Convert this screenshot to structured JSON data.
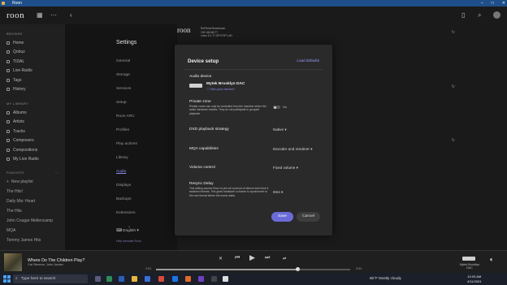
{
  "window": {
    "title": "Roon"
  },
  "app": {
    "logo": "roon"
  },
  "sidebar": {
    "browse_header": "BROWSE",
    "browse": [
      "Home",
      "Qobuz",
      "TIDAL",
      "Live Radio",
      "Tags",
      "History"
    ],
    "library_header": "MY LIBRARY",
    "library": [
      "Albums",
      "Artists",
      "Tracks",
      "Composers",
      "Compositions",
      "My Live Radio"
    ],
    "playlists_header": "PLAYLISTS",
    "new_playlist": "New playlist",
    "playlists": [
      "The Hits!",
      "Daily Mix: Heart",
      "The Hits",
      "John Cougar Mellencamp",
      "MQA",
      "Tommy James Hits"
    ]
  },
  "settings": {
    "title": "Settings",
    "nav": [
      "General",
      "Storage",
      "Services",
      "Setup",
      "Roon ARC",
      "Profiles",
      "Play actions",
      "Library",
      "Audio",
      "Displays",
      "Backups",
      "Extensions"
    ],
    "active": "Audio",
    "language": "English",
    "language_help": "Help translate Roon"
  },
  "info_panel": {
    "logo": "roon",
    "device_lines": [
      "RoPieee/Gearbroom",
      "192.168.68.77",
      "Linux 6.1.77-SPOTIFY-v8+"
    ]
  },
  "modal": {
    "title": "Device setup",
    "load_defaults": "Load defaults",
    "audio_device_label": "Audio device",
    "device_name": "Mytek Brooklyn DAC",
    "device_link": "Not your device?",
    "private_zone_label": "Private zone",
    "private_zone_desc": "Private zones can only be controlled from the machine where the audio hardware resides. They do not participate in grouped playback.",
    "private_zone_value": "No",
    "dsd_label": "DSD playback strategy",
    "dsd_value": "Native",
    "mqa_label": "MQA capabilities",
    "mqa_value": "Decoder and renderer",
    "volume_label": "Volume control",
    "volume_value": "Fixed volume",
    "resync_label": "Resync Delay",
    "resync_desc": "This setting causes Roon to pre-roll a period of silence each time it switches formats. This gives hardware a chance to synchronize to the new format before the music starts.",
    "resync_value": "0ms",
    "save": "Save",
    "cancel": "Cancel"
  },
  "player": {
    "track": "Where Do The Children Play?",
    "artist": "Cat Stevens, John Jordan",
    "elapsed": "2:51",
    "duration": "3:54",
    "progress": 0.73,
    "zone": "Mytek Brooklyn DAC"
  },
  "taskbar": {
    "search_placeholder": "Type here to search",
    "weather": "66°F Mostly cloudy",
    "time": "10:03 AM",
    "date": "4/11/2024"
  }
}
